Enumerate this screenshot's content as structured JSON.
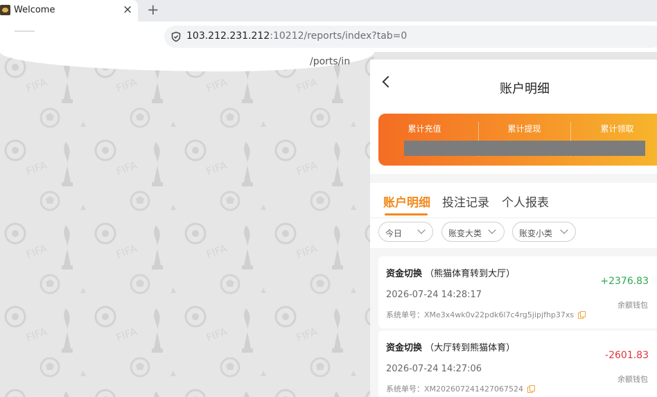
{
  "browser": {
    "tab_title": "Welcome",
    "tab_close": "×",
    "new_tab": "+",
    "url_host": "103.212.231.212",
    "url_rest": ":10212/reports/index?tab=0",
    "partial_url_text": "/ports/in"
  },
  "header": {
    "title": "账户明细"
  },
  "summary": {
    "items": [
      {
        "label": "累计充值"
      },
      {
        "label": "累计提现"
      },
      {
        "label": "累计领取"
      }
    ]
  },
  "tabs": [
    {
      "label": "账户明细",
      "active": true
    },
    {
      "label": "投注记录",
      "active": false
    },
    {
      "label": "个人报表",
      "active": false
    }
  ],
  "filters": [
    {
      "label": "今日"
    },
    {
      "label": "账变大类"
    },
    {
      "label": "账变小类"
    }
  ],
  "records": [
    {
      "title": "资金切换",
      "detail": "（熊猫体育转到大厅）",
      "datetime": "2026-07-24 14:28:17",
      "order_label": "系统单号：",
      "order_no": "XMe3x4wk0v22pdk6l7c4rg5jipjfhp37xs",
      "amount": "+2376.83",
      "direction": "in",
      "wallet": "余额钱包"
    },
    {
      "title": "资金切换",
      "detail": "（大厅转到熊猫体育）",
      "datetime": "2026-07-24 14:27:06",
      "order_label": "系统单号：",
      "order_no": "XM2026072414270675​24",
      "amount": "-2601.83",
      "direction": "out",
      "wallet": "余额钱包"
    }
  ],
  "colors": {
    "accent": "#f28a1c",
    "positive": "#2fa84f",
    "negative": "#e1333b",
    "banner_start": "#f46d23",
    "banner_end": "#f7b82d"
  }
}
